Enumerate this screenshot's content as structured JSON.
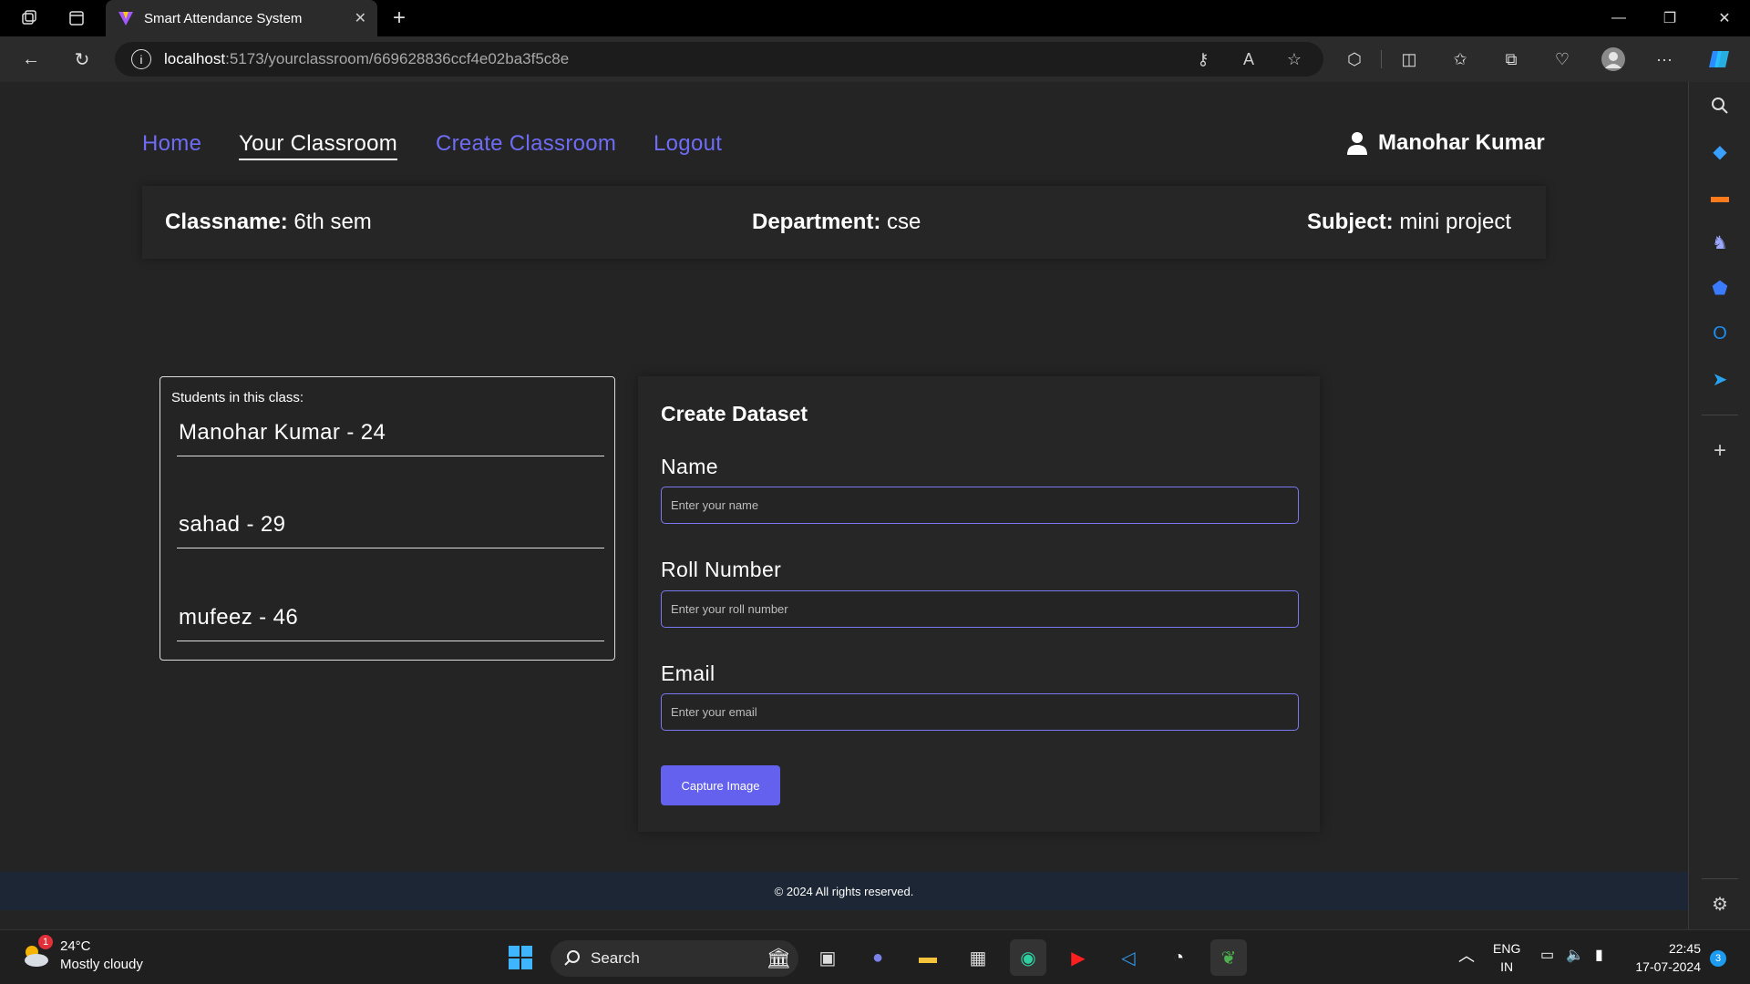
{
  "browser": {
    "tab_title": "Smart Attendance System",
    "url_host": "localhost",
    "url_path": ":5173/yourclassroom/669628836ccf4e02ba3f5c8e"
  },
  "nav": {
    "home": "Home",
    "your_classroom": "Your Classroom",
    "create_classroom": "Create Classroom",
    "logout": "Logout",
    "user_name": "Manohar Kumar"
  },
  "classinfo": {
    "classname_label": "Classname:",
    "classname_value": "6th sem",
    "department_label": "Department:",
    "department_value": "cse",
    "subject_label": "Subject:",
    "subject_value": "mini project"
  },
  "students": {
    "header": "Students in this class:",
    "list": [
      "Manohar Kumar - 24",
      "sahad - 29",
      "mufeez - 46"
    ]
  },
  "dataset": {
    "title": "Create Dataset",
    "name_label": "Name",
    "name_placeholder": "Enter your name",
    "roll_label": "Roll Number",
    "roll_placeholder": "Enter your roll number",
    "email_label": "Email",
    "email_placeholder": "Enter your email",
    "capture_button": "Capture Image"
  },
  "footer": {
    "text": "© 2024 All rights reserved."
  },
  "taskbar": {
    "weather_temp": "24°C",
    "weather_desc": "Mostly cloudy",
    "weather_badge": "1",
    "search_label": "Search",
    "lang_top": "ENG",
    "lang_bottom": "IN",
    "time": "22:45",
    "date": "17-07-2024",
    "notif_count": "3"
  },
  "colors": {
    "accent": "#6461ee",
    "link": "#6e6cf5",
    "background": "#242424",
    "footer": "#1c2634"
  }
}
